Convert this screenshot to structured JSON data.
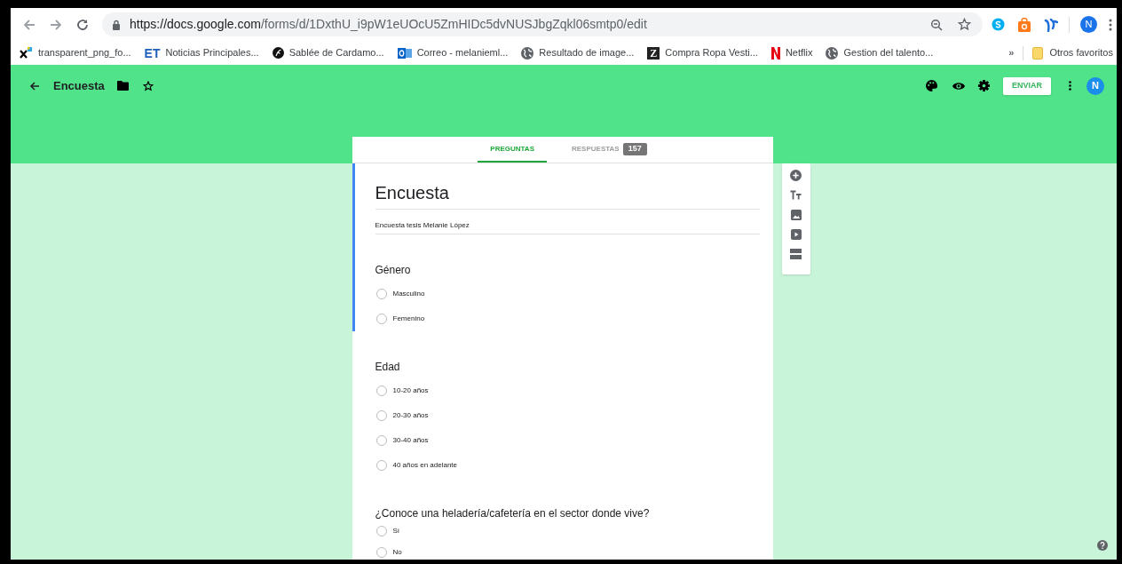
{
  "browser": {
    "url_host": "https://docs.google.com",
    "url_path": "/forms/d/1DxthU_i9pW1eUOcU5ZmHIDc5dvNUSJbgZqkl06smtp0/edit",
    "profile_initial": "N"
  },
  "bookmarks": [
    {
      "kind": "x-logo",
      "label": "transparent_png_fo..."
    },
    {
      "kind": "text-logo",
      "icon_text": "ET",
      "label": "Noticias Principales..."
    },
    {
      "kind": "round-logo",
      "label": "Sablée de Cardamo..."
    },
    {
      "kind": "mail-logo",
      "label": "Correo - melanieml..."
    },
    {
      "kind": "globe",
      "label": "Resultado de image..."
    },
    {
      "kind": "text-logo",
      "icon_text": "Z",
      "label": "Compra Ropa Vesti..."
    },
    {
      "kind": "netflix",
      "label": "Netflix"
    },
    {
      "kind": "globe",
      "label": "Gestion del talento..."
    }
  ],
  "bookmarks_overflow": "»",
  "other_bookmarks": "Otros favoritos",
  "app_bar": {
    "title": "Encuesta",
    "send_button": "ENVIAR",
    "avatar": "N"
  },
  "tabs": [
    {
      "label": "PREGUNTAS",
      "selected": true
    },
    {
      "label": "RESPUESTAS",
      "selected": false,
      "count": "157"
    }
  ],
  "form": {
    "title": "Encuesta",
    "description": "Encuesta tesis Melanie López",
    "active": true
  },
  "questions": [
    {
      "title": "Género",
      "active": true,
      "options": [
        {
          "label": "Masculino",
          "selected": false
        },
        {
          "label": "Femenino",
          "selected": false
        }
      ]
    },
    {
      "title": "Edad",
      "active": false,
      "options": [
        {
          "label": "10-20 años",
          "selected": false
        },
        {
          "label": "20-30 años",
          "selected": false
        },
        {
          "label": "30-40 años",
          "selected": false
        },
        {
          "label": "40 años en adelante",
          "selected": false
        }
      ]
    },
    {
      "title": "¿Conoce una heladería/cafetería en el sector donde vive?",
      "active": false,
      "options": [
        {
          "label": "Sí",
          "selected": false
        },
        {
          "label": "No",
          "selected": false
        }
      ]
    }
  ]
}
